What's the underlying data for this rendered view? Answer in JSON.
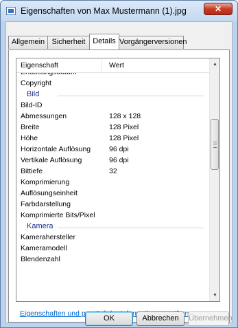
{
  "window": {
    "title": "Eigenschaften von Max Mustermann (1).jpg",
    "close_symbol": "✕"
  },
  "tabs": [
    "Allgemein",
    "Sicherheit",
    "Details",
    "Vorgängerversionen"
  ],
  "list": {
    "columns": {
      "property": "Eigenschaft",
      "value": "Wert"
    },
    "rows": [
      {
        "k": "Erfassungsdatum",
        "v": ""
      },
      {
        "k": "Copyright",
        "v": ""
      },
      {
        "group": "Bild"
      },
      {
        "k": "Bild-ID",
        "v": ""
      },
      {
        "k": "Abmessungen",
        "v": "128 x 128"
      },
      {
        "k": "Breite",
        "v": "128 Pixel"
      },
      {
        "k": "Höhe",
        "v": "128 Pixel"
      },
      {
        "k": "Horizontale Auflösung",
        "v": "96 dpi"
      },
      {
        "k": "Vertikale Auflösung",
        "v": "96 dpi"
      },
      {
        "k": "Bittiefe",
        "v": "32"
      },
      {
        "k": "Komprimierung",
        "v": ""
      },
      {
        "k": "Auflösungseinheit",
        "v": ""
      },
      {
        "k": "Farbdarstellung",
        "v": ""
      },
      {
        "k": "Komprimierte Bits/Pixel",
        "v": ""
      },
      {
        "group": "Kamera"
      },
      {
        "k": "Kamerahersteller",
        "v": ""
      },
      {
        "k": "Kameramodell",
        "v": ""
      },
      {
        "k": "Blendenzahl",
        "v": ""
      }
    ]
  },
  "link_text": "Eigenschaften und persönliche Informationen entfernen",
  "buttons": {
    "ok": "OK",
    "cancel": "Abbrechen",
    "apply": "Übernehmen"
  },
  "icons": {
    "scroll_up": "up-arrow-icon",
    "scroll_down": "down-arrow-icon"
  }
}
